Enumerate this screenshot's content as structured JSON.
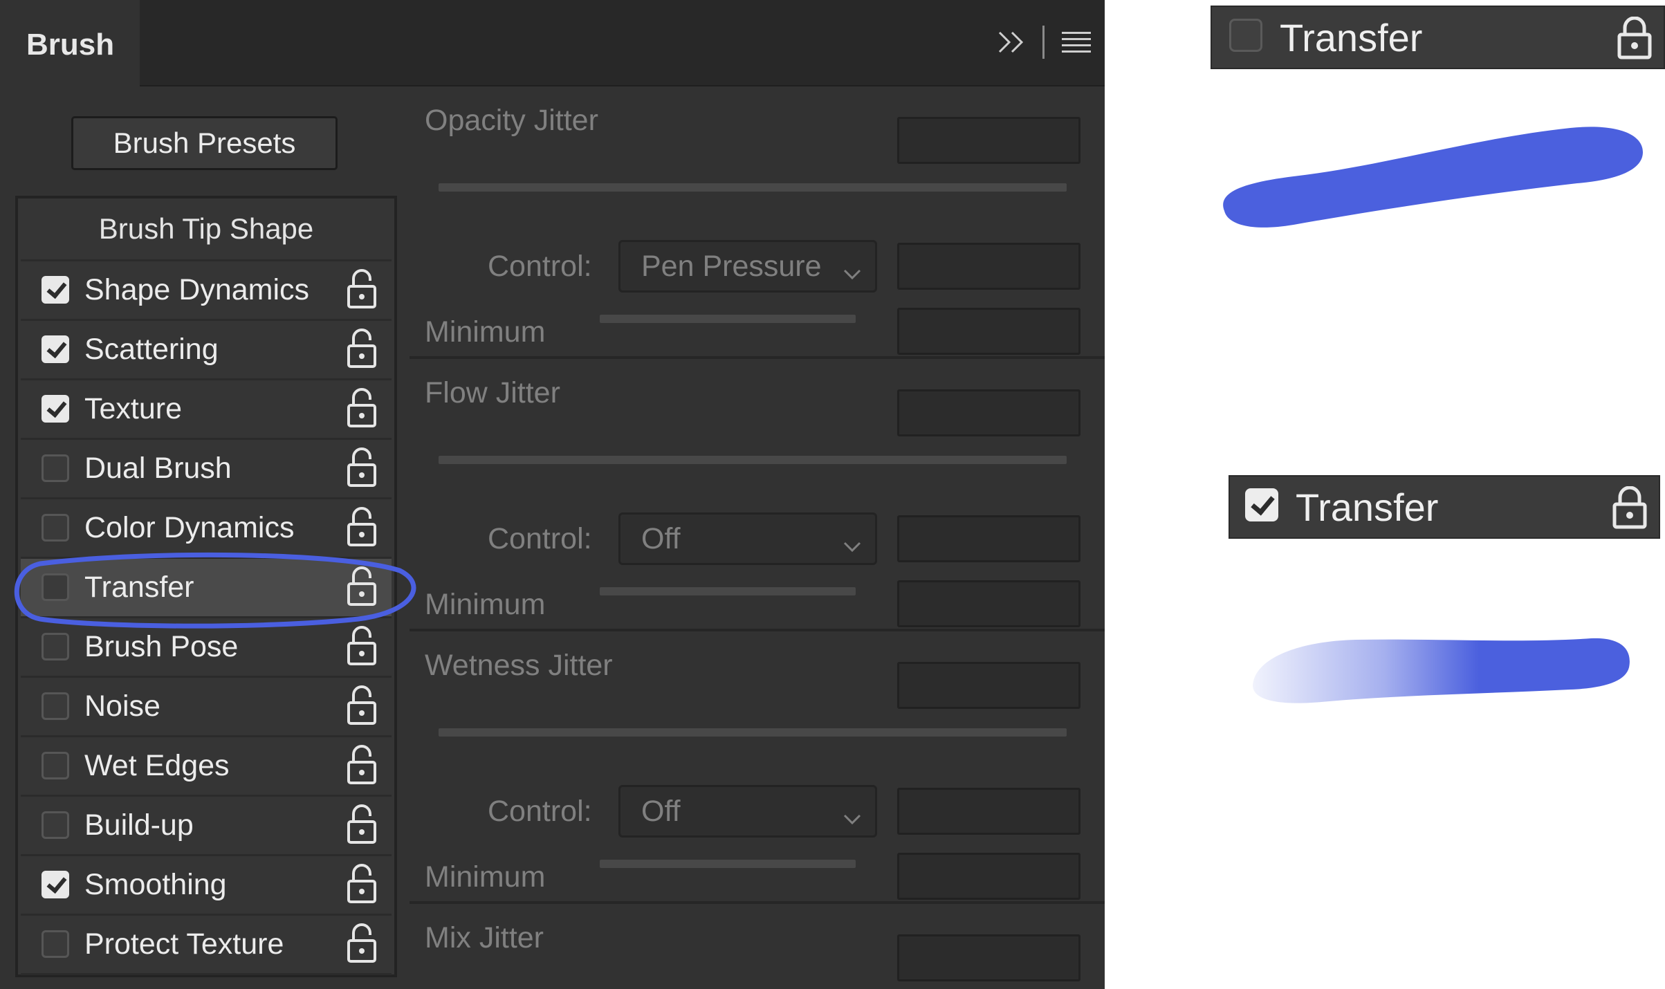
{
  "panel": {
    "tab_title": "Brush",
    "icons": [
      "double-chevron-right-icon",
      "hamburger-menu-icon"
    ],
    "presets_button": "Brush Presets",
    "list_header": "Brush Tip Shape",
    "items": [
      {
        "label": "Shape Dynamics",
        "checked": true
      },
      {
        "label": "Scattering",
        "checked": true
      },
      {
        "label": "Texture",
        "checked": true
      },
      {
        "label": "Dual Brush",
        "checked": false
      },
      {
        "label": "Color Dynamics",
        "checked": false
      },
      {
        "label": "Transfer",
        "checked": false,
        "selected": true
      },
      {
        "label": "Brush Pose",
        "checked": false
      },
      {
        "label": "Noise",
        "checked": false
      },
      {
        "label": "Wet Edges",
        "checked": false
      },
      {
        "label": "Build-up",
        "checked": false
      },
      {
        "label": "Smoothing",
        "checked": true
      },
      {
        "label": "Protect Texture",
        "checked": false
      }
    ]
  },
  "settings": {
    "opacity": {
      "title": "Opacity Jitter",
      "control_label": "Control:",
      "control_value": "Pen Pressure",
      "minimum_label": "Minimum"
    },
    "flow": {
      "title": "Flow Jitter",
      "control_label": "Control:",
      "control_value": "Off",
      "minimum_label": "Minimum"
    },
    "wetness": {
      "title": "Wetness Jitter",
      "control_label": "Control:",
      "control_value": "Off",
      "minimum_label": "Minimum"
    },
    "mix": {
      "title": "Mix Jitter"
    }
  },
  "demo": {
    "off": {
      "label": "Transfer",
      "checked": false
    },
    "on": {
      "label": "Transfer",
      "checked": true
    }
  },
  "colors": {
    "panel_bg": "#323232",
    "highlight_circle": "#4a5fe0",
    "stroke_color": "#4b60de"
  }
}
